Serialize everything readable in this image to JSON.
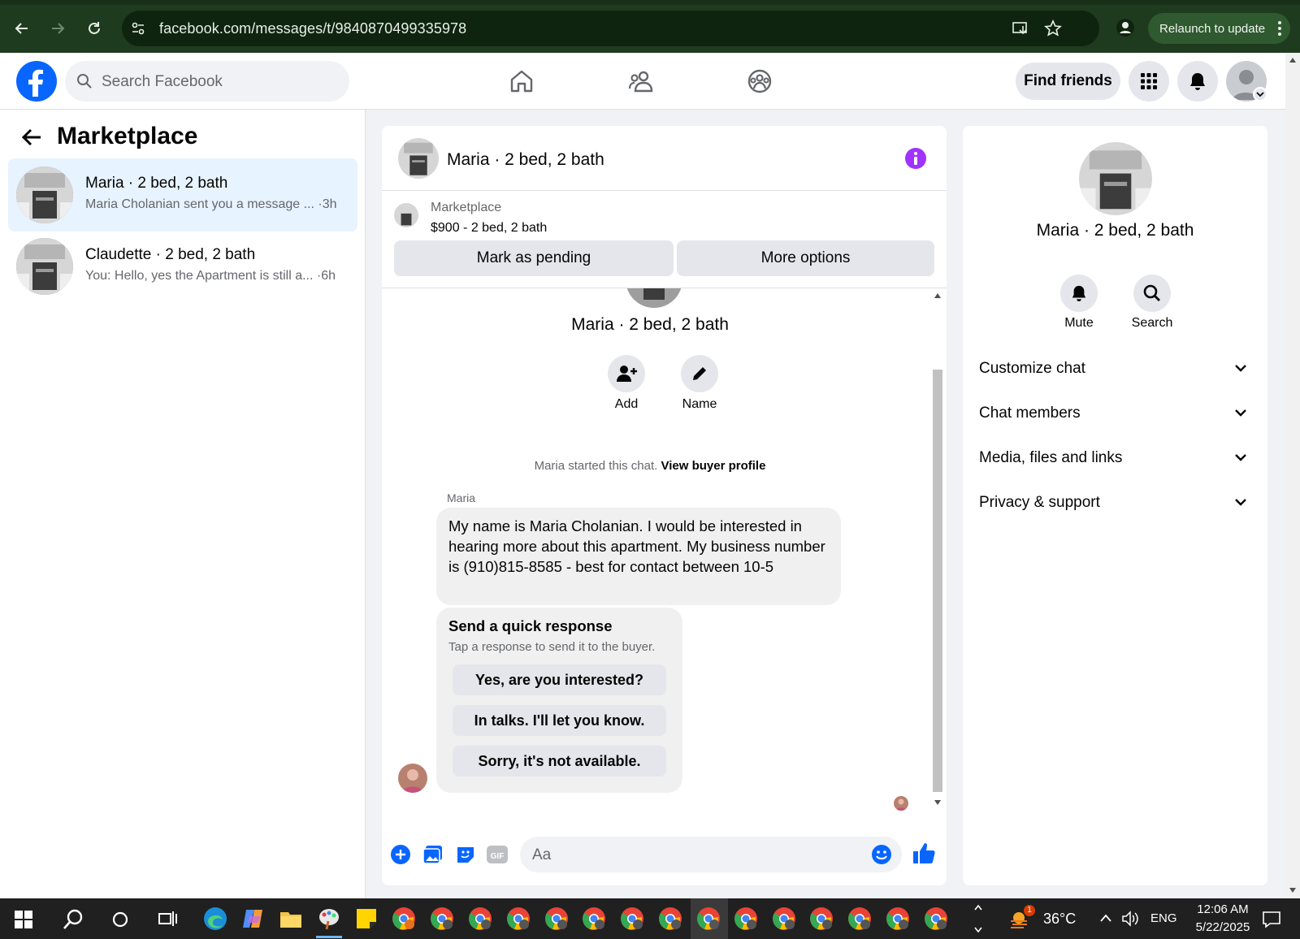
{
  "browser": {
    "url": "facebook.com/messages/t/9840870499335978",
    "relaunch_label": "Relaunch to update"
  },
  "header": {
    "search_placeholder": "Search Facebook",
    "find_friends": "Find friends"
  },
  "sidebar": {
    "title": "Marketplace",
    "conversations": [
      {
        "name": "Maria · 2 bed, 2 bath",
        "preview": "Maria Cholanian sent you a message ...",
        "time": "·3h"
      },
      {
        "name": "Claudette · 2 bed, 2 bath",
        "preview": "You: Hello, yes the Apartment is still a...",
        "time": "·6h"
      }
    ]
  },
  "chat": {
    "title": "Maria · 2 bed, 2 bath",
    "listing_source": "Marketplace",
    "listing_desc": "$900 - 2 bed, 2 bath",
    "mark_pending": "Mark as pending",
    "more_options": "More options",
    "profile_name": "Maria · 2 bed, 2 bath",
    "add_label": "Add",
    "name_label": "Name",
    "started_text": "Maria started this chat.",
    "view_buyer": "View buyer profile",
    "sender": "Maria",
    "message": "My name is Maria Cholanian. I would be interested in hearing more about this apartment. My business number is (910)815-8585 - best for contact between 10-5",
    "quick_title": "Send a quick response",
    "quick_sub": "Tap a response to send it to the buyer.",
    "quick_responses": [
      "Yes, are you interested?",
      "In talks. I'll let you know.",
      "Sorry, it's not available."
    ],
    "input_placeholder": "Aa"
  },
  "details": {
    "name": "Maria · 2 bed, 2 bath",
    "mute": "Mute",
    "search": "Search",
    "sections": [
      "Customize chat",
      "Chat members",
      "Media, files and links",
      "Privacy & support"
    ]
  },
  "taskbar": {
    "temperature": "36°C",
    "language": "ENG",
    "time": "12:06 AM",
    "date": "5/22/2025",
    "weather_badge": "1"
  },
  "colors": {
    "fb_blue": "#0866ff",
    "info_purple": "#a033ff",
    "chrome_green": "#1f3b1f"
  }
}
